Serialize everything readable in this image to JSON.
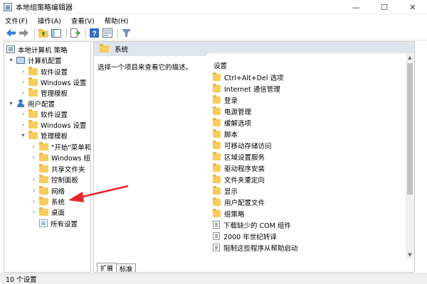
{
  "window": {
    "title": "本地组策略编辑器",
    "controls": [
      "—",
      "☐",
      "✕"
    ]
  },
  "menu": [
    "文件(F)",
    "操作(A)",
    "查看(V)",
    "帮助(H)"
  ],
  "toolbar": {
    "icons": [
      "back-arrow-icon",
      "forward-arrow-icon",
      "up-folder-icon",
      "show-tree-icon",
      "export-list-icon",
      "help-icon",
      "properties-icon",
      "filter-icon"
    ]
  },
  "tree": {
    "items": [
      {
        "label": "本地计算机 策略",
        "level": 0,
        "expander": "",
        "icon": "policy"
      },
      {
        "label": "计算机配置",
        "level": 1,
        "expander": "▾",
        "icon": "computer"
      },
      {
        "label": "软件设置",
        "level": 2,
        "expander": "›",
        "icon": "folder"
      },
      {
        "label": "Windows 设置",
        "level": 2,
        "expander": "›",
        "icon": "folder"
      },
      {
        "label": "管理模板",
        "level": 2,
        "expander": "›",
        "icon": "folder"
      },
      {
        "label": "用户配置",
        "level": 1,
        "expander": "▾",
        "icon": "user"
      },
      {
        "label": "软件设置",
        "level": 2,
        "expander": "›",
        "icon": "folder"
      },
      {
        "label": "Windows 设置",
        "level": 2,
        "expander": "›",
        "icon": "folder"
      },
      {
        "label": "管理模板",
        "level": 2,
        "expander": "▾",
        "icon": "folder"
      },
      {
        "label": "\"开始\"菜单和",
        "level": 3,
        "expander": "›",
        "icon": "folder"
      },
      {
        "label": "Windows 组",
        "level": 3,
        "expander": "›",
        "icon": "folder"
      },
      {
        "label": "共享文件夹",
        "level": 3,
        "expander": "",
        "icon": "folder"
      },
      {
        "label": "控制面板",
        "level": 3,
        "expander": "›",
        "icon": "folder"
      },
      {
        "label": "网络",
        "level": 3,
        "expander": "›",
        "icon": "folder"
      },
      {
        "label": "系统",
        "level": 3,
        "expander": "›",
        "icon": "folder"
      },
      {
        "label": "桌面",
        "level": 3,
        "expander": "›",
        "icon": "folder"
      },
      {
        "label": "所有设置",
        "level": 3,
        "expander": "",
        "icon": "allsettings"
      }
    ]
  },
  "content": {
    "header_title": "系统",
    "description": "选择一个项目来查看它的描述。",
    "column_header": "设置",
    "items": [
      {
        "label": "Ctrl+Alt+Del 选项",
        "icon": "folder"
      },
      {
        "label": "Internet 通信管理",
        "icon": "folder"
      },
      {
        "label": "登录",
        "icon": "folder"
      },
      {
        "label": "电源管理",
        "icon": "folder"
      },
      {
        "label": "缓解选项",
        "icon": "folder"
      },
      {
        "label": "脚本",
        "icon": "folder"
      },
      {
        "label": "可移动存储访问",
        "icon": "folder"
      },
      {
        "label": "区域设置服务",
        "icon": "folder"
      },
      {
        "label": "驱动程序安装",
        "icon": "folder"
      },
      {
        "label": "文件夹重定向",
        "icon": "folder"
      },
      {
        "label": "显示",
        "icon": "folder"
      },
      {
        "label": "用户配置文件",
        "icon": "folder"
      },
      {
        "label": "组策略",
        "icon": "folder"
      },
      {
        "label": "下载缺少的 COM 组件",
        "icon": "setting"
      },
      {
        "label": "2000 年世纪转译",
        "icon": "setting"
      },
      {
        "label": "阻制这些程序从帮助启动",
        "icon": "setting"
      }
    ]
  },
  "tabs": [
    "扩展",
    "标准"
  ],
  "status": "10 个设置",
  "colors": {
    "annotation_arrow": "#e8232a",
    "content_header_bg": "#dde5ee"
  }
}
